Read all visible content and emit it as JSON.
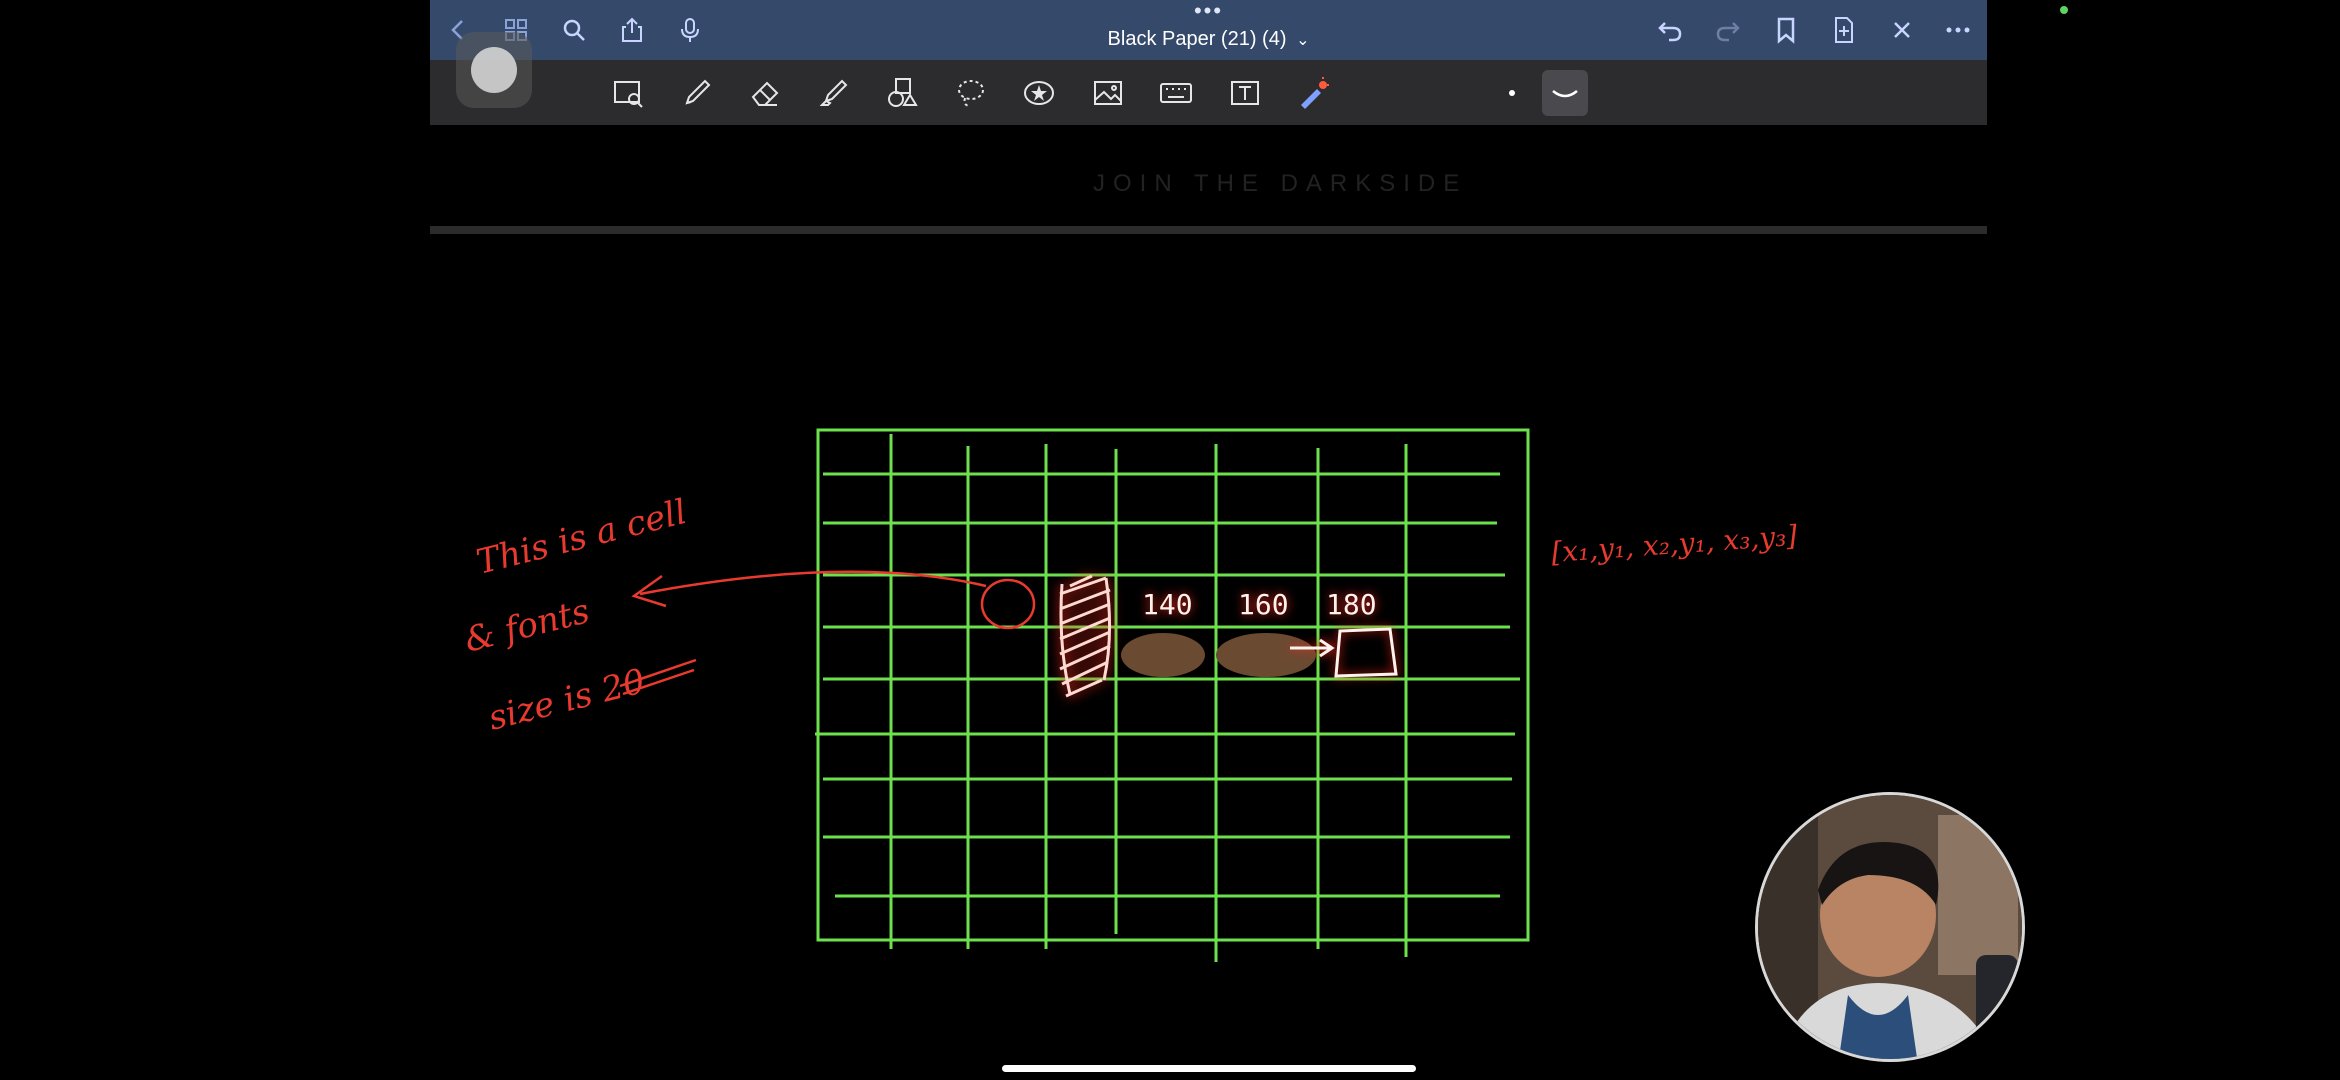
{
  "window": {
    "title": "Black Paper  (21) (4)",
    "title_chevron": "⌄"
  },
  "topbar": {
    "left_buttons": [
      "back-icon",
      "grid-icon",
      "search-icon",
      "share-icon",
      "mic-icon"
    ],
    "right_buttons": [
      "undo-icon",
      "redo-icon",
      "bookmark-icon",
      "add-page-icon",
      "close-icon",
      "more-icon"
    ],
    "more_glyph": "•••"
  },
  "toolbar": {
    "tools": [
      "image-zoom-icon",
      "pen-icon",
      "eraser-icon",
      "highlighter-icon",
      "shapes-icon",
      "lasso-icon",
      "elements-icon",
      "image-icon",
      "keyboard-icon",
      "text-icon",
      "laser-pointer-icon"
    ],
    "pen_size": "dot",
    "stroke_style": "curve"
  },
  "page": {
    "watermark": "JOIN THE DARKSIDE"
  },
  "annotations": {
    "left_note_lines": [
      "This is a cell",
      "& fonts",
      "size is 20"
    ],
    "cell_labels": [
      "140",
      "160",
      "180"
    ],
    "right_note": "[x₁,y₁, x₂,y₁, x₃,y₃]"
  },
  "colors": {
    "grid": "#6de04e",
    "ink": "#e83a2e",
    "topbar": "#35496b",
    "toolbar": "#2c2c2e",
    "accent": "#c8d6ff"
  },
  "webcam": {
    "label": "presenter-webcam"
  }
}
